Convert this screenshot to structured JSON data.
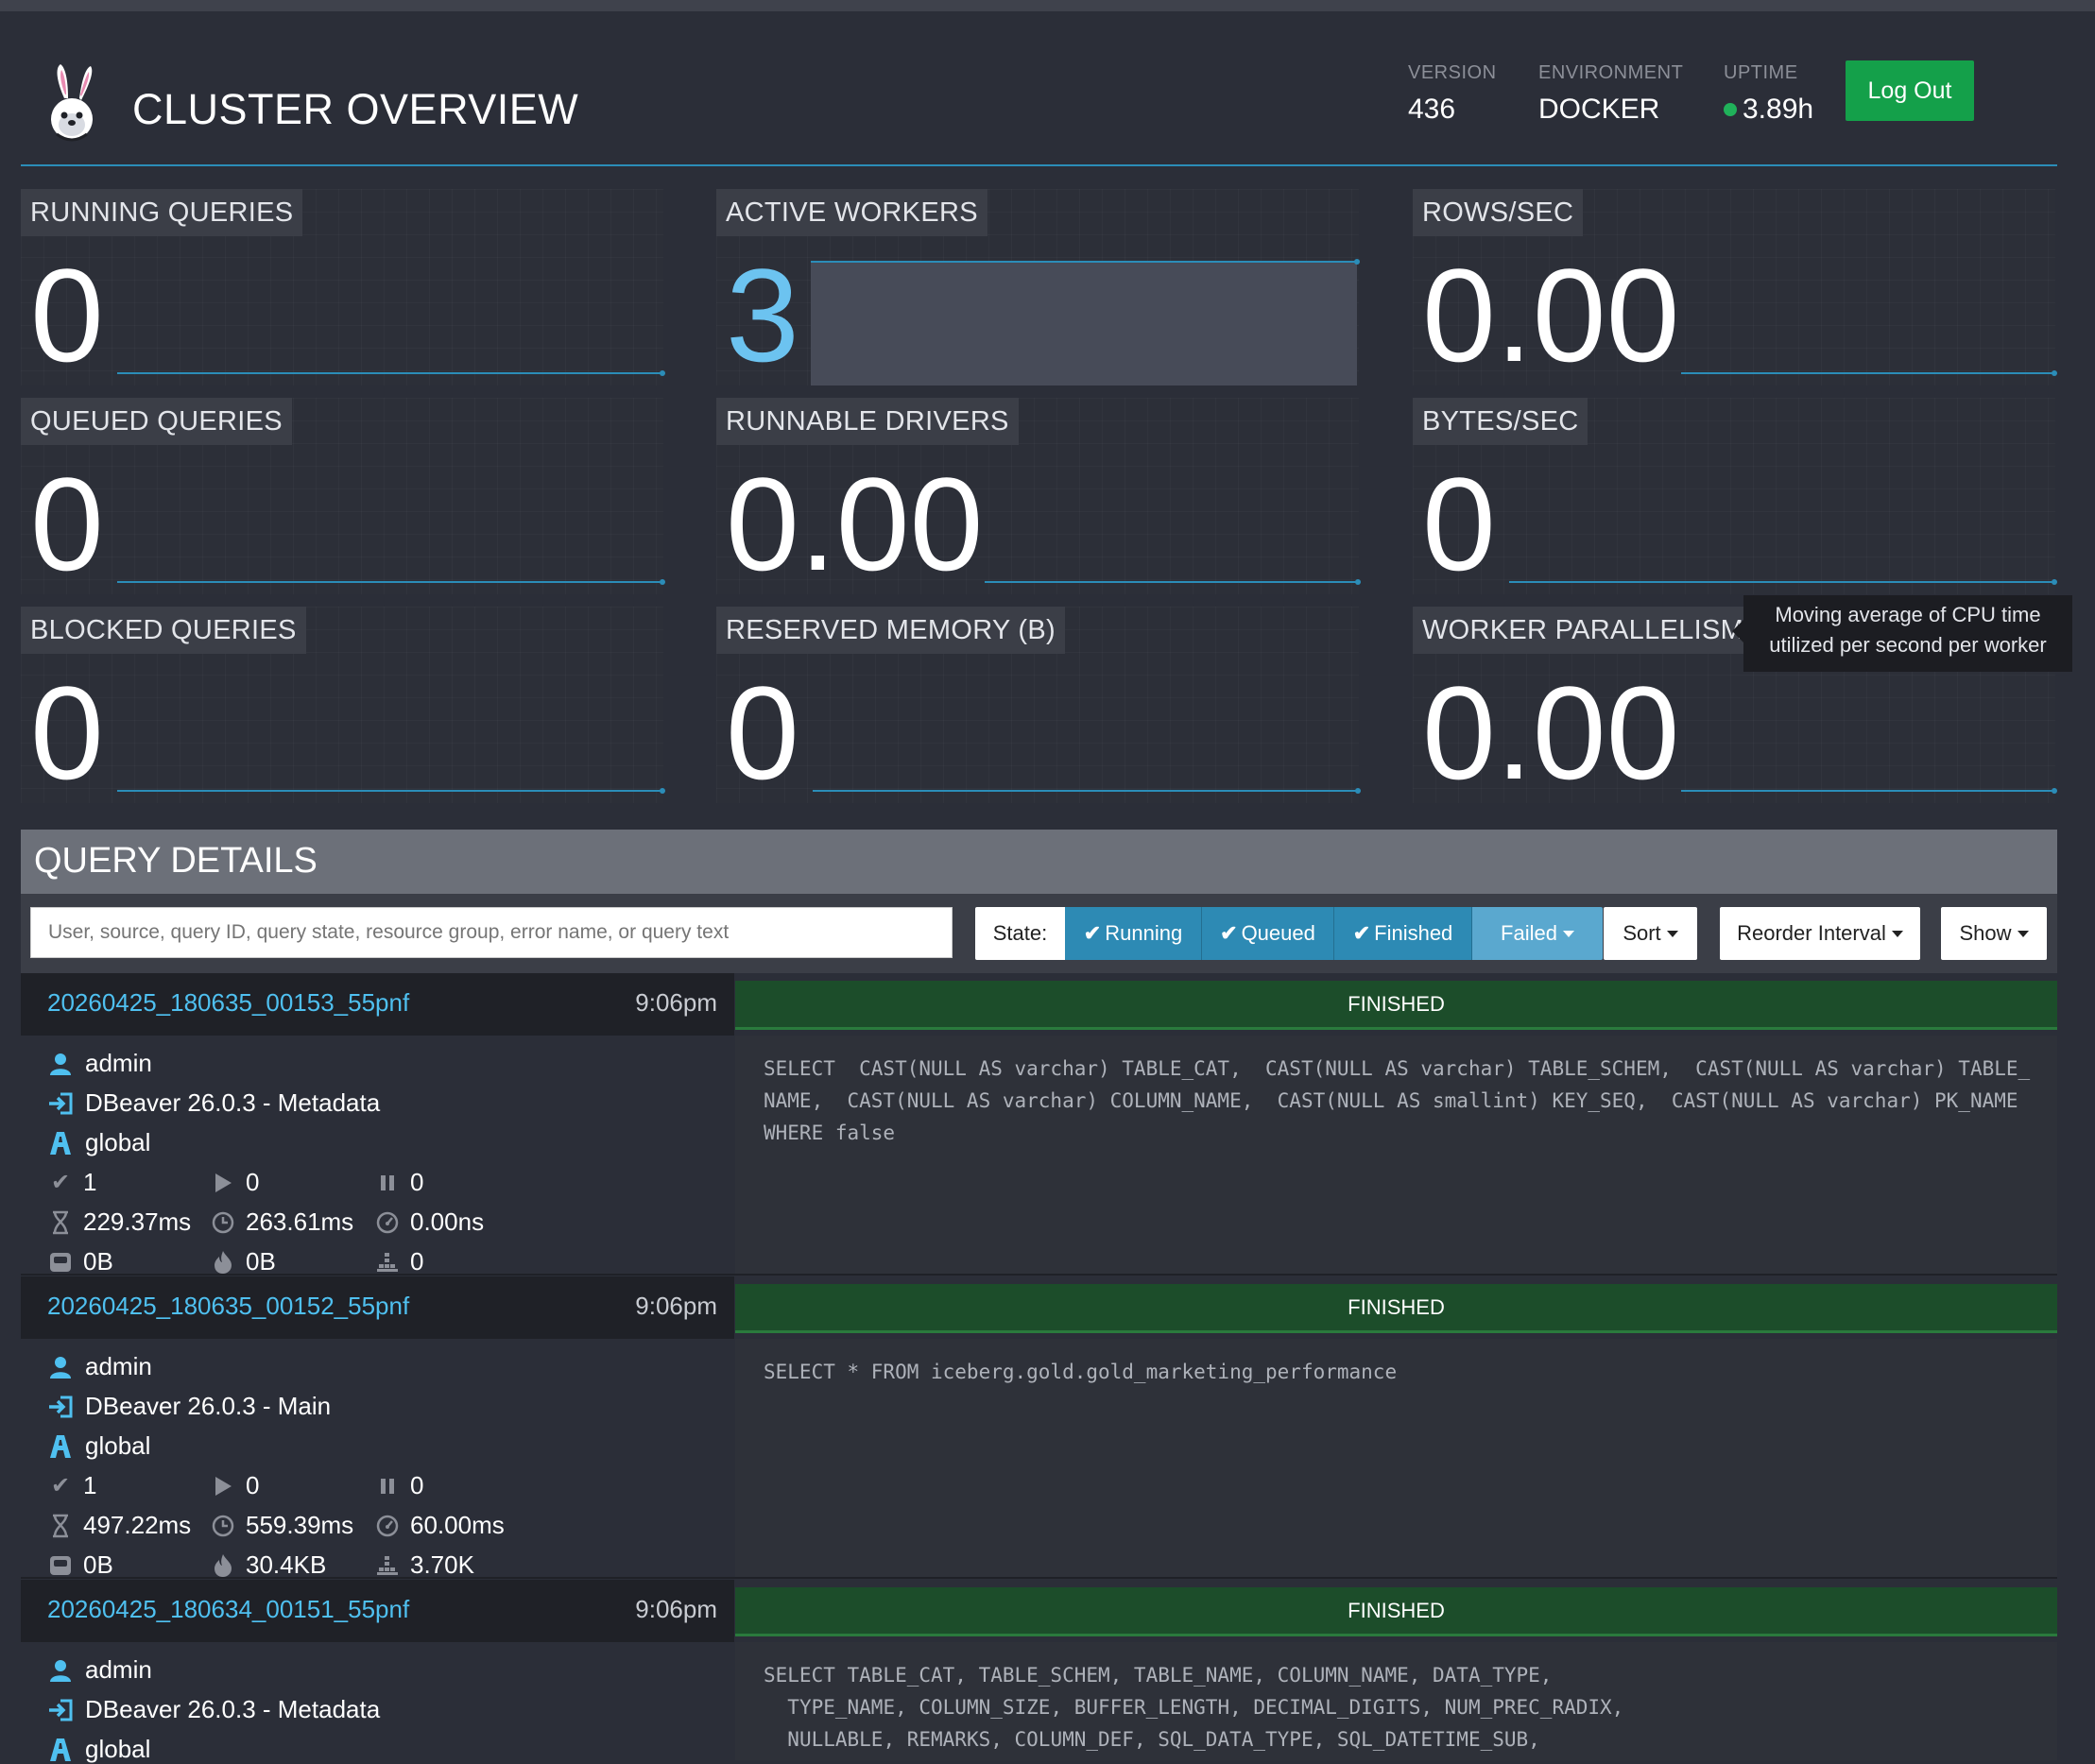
{
  "header": {
    "title": "CLUSTER OVERVIEW",
    "version_label": "VERSION",
    "version": "436",
    "environment_label": "ENVIRONMENT",
    "environment": "DOCKER",
    "uptime_label": "UPTIME",
    "uptime": "3.89h",
    "logout": "Log Out"
  },
  "metrics": {
    "running_queries": {
      "label": "RUNNING QUERIES",
      "value": "0"
    },
    "active_workers": {
      "label": "ACTIVE WORKERS",
      "value": "3"
    },
    "rows_sec": {
      "label": "ROWS/SEC",
      "value": "0.00"
    },
    "queued_queries": {
      "label": "QUEUED QUERIES",
      "value": "0"
    },
    "runnable_drivers": {
      "label": "RUNNABLE DRIVERS",
      "value": "0.00"
    },
    "bytes_sec": {
      "label": "BYTES/SEC",
      "value": "0"
    },
    "blocked_queries": {
      "label": "BLOCKED QUERIES",
      "value": "0"
    },
    "reserved_memory": {
      "label": "RESERVED MEMORY (B)",
      "value": "0"
    },
    "worker_parallelism": {
      "label": "WORKER PARALLELISM",
      "value": "0.00"
    }
  },
  "tooltip": {
    "line1": "Moving average of CPU time",
    "line2": "utilized per second per worker"
  },
  "query_details": {
    "title": "QUERY DETAILS",
    "search_placeholder": "User, source, query ID, query state, resource group, error name, or query text",
    "state_label": "State:",
    "filters": {
      "running": "Running",
      "queued": "Queued",
      "finished": "Finished",
      "failed": "Failed"
    },
    "sort": "Sort",
    "reorder": "Reorder Interval",
    "show": "Show"
  },
  "queries": [
    {
      "id": "20260425_180635_00153_55pnf",
      "time": "9:06pm",
      "state": "FINISHED",
      "user": "admin",
      "source": "DBeaver 26.0.3 - Metadata",
      "resource_group": "global",
      "completed": "1",
      "running": "0",
      "queued": "0",
      "elapsed": "229.37ms",
      "wall": "263.61ms",
      "cpu": "0.00ns",
      "memory": "0B",
      "peak": "0B",
      "rows": "0",
      "sql": "SELECT  CAST(NULL AS varchar) TABLE_CAT,  CAST(NULL AS varchar) TABLE_SCHEM,  CAST(NULL AS varchar) TABLE_NAME,  CAST(NULL AS varchar) COLUMN_NAME,  CAST(NULL AS smallint) KEY_SEQ,  CAST(NULL AS varchar) PK_NAME WHERE false"
    },
    {
      "id": "20260425_180635_00152_55pnf",
      "time": "9:06pm",
      "state": "FINISHED",
      "user": "admin",
      "source": "DBeaver 26.0.3 - Main",
      "resource_group": "global",
      "completed": "1",
      "running": "0",
      "queued": "0",
      "elapsed": "497.22ms",
      "wall": "559.39ms",
      "cpu": "60.00ms",
      "memory": "0B",
      "peak": "30.4KB",
      "rows": "3.70K",
      "sql": "SELECT * FROM iceberg.gold.gold_marketing_performance"
    },
    {
      "id": "20260425_180634_00151_55pnf",
      "time": "9:06pm",
      "state": "FINISHED",
      "user": "admin",
      "source": "DBeaver 26.0.3 - Metadata",
      "resource_group": "global",
      "sql": "SELECT TABLE_CAT, TABLE_SCHEM, TABLE_NAME, COLUMN_NAME, DATA_TYPE,\n  TYPE_NAME, COLUMN_SIZE, BUFFER_LENGTH, DECIMAL_DIGITS, NUM_PREC_RADIX,\n  NULLABLE, REMARKS, COLUMN_DEF, SQL_DATA_TYPE, SQL_DATETIME_SUB,\n  CHAR_OCTET_LENGTH, ORDINAL_POSITION, IS_NULLABLE,"
    }
  ]
}
